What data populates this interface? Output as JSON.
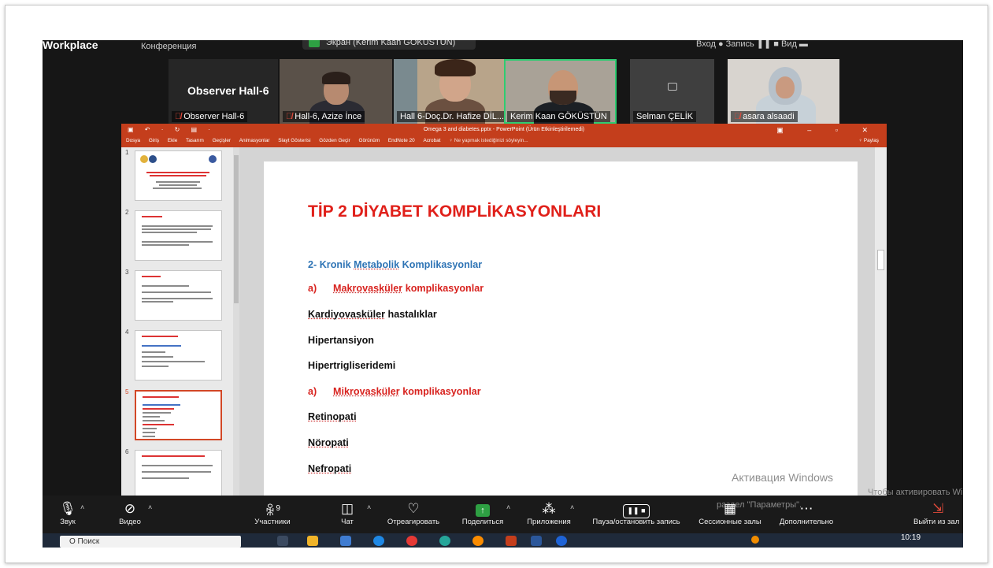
{
  "top": {
    "app_name": "Workplace",
    "conference_label": "Конференция",
    "share_pill": "Экран (Kerim Kaan GÖKÜSTÜN)",
    "right_status": "Вход   ●   Запись  ❚❚  ■   Вид  ▬"
  },
  "participants": [
    {
      "name": "Observer Hall-6",
      "big_label": "Observer Hall-6",
      "muted": true
    },
    {
      "name": "Hall-6, Azize İnce",
      "muted": true
    },
    {
      "name": "Hall 6-Doç.Dr. Hafize DİL...",
      "muted": false
    },
    {
      "name": "Kerim Kaan GÖKÜSTÜN",
      "muted": false,
      "active": true
    },
    {
      "name": "Selman ÇELİK",
      "muted": false
    },
    {
      "name": "asara alsaadi",
      "muted": true
    }
  ],
  "powerpoint": {
    "window_title": "Omega 3 and diabetes.pptx - PowerPoint (Ürün Etkinleştirilemedi)",
    "qat": "▣ ↶ · ↻ ▤ ·",
    "win_buttons": "▣ – ▫ ✕",
    "ribbon_tabs": [
      "Dosya",
      "Giriş",
      "Ekle",
      "Tasarım",
      "Geçişler",
      "Animasyonlar",
      "Slayt Gösterisi",
      "Gözden Geçir",
      "Görünüm",
      "EndNote 20",
      "Acrobat",
      "♀ Ne yapmak istediğinizi söyleyin..."
    ],
    "share_label": "♀ Paylaş",
    "thumb_numbers": [
      "1",
      "2",
      "3",
      "4",
      "5",
      "6"
    ]
  },
  "slide": {
    "title": "TİP 2 DİYABET KOMPLİKASYONLARI",
    "heading_prefix": "2- Kronik ",
    "heading_ul": "Metabolik",
    "heading_suffix": " Komplikasyonlar",
    "macro_letter": "a)",
    "macro_ul": "Makrovasküler",
    "macro_suffix": " komplikasyonlar",
    "cardio_ul": "Kardiyovasküler",
    "cardio_suffix": " hastalıklar",
    "hypertension": "Hipertansiyon",
    "hypertrig": "Hipertrigliseridemi",
    "micro_letter": "a)",
    "micro_ul": "Mikrovasküler",
    "micro_suffix": " komplikasyonlar",
    "retinopathy": "Retinopati",
    "neuropathy": "Nöropati",
    "nephropathy": "Nefropati"
  },
  "watermark": {
    "line1": "Активация Windows",
    "line2": "Чтобы активировать Windows, перейдите в",
    "line3": "раздел \"Параметры\"."
  },
  "toolbar": {
    "audio": "Звук",
    "video": "Видео",
    "participants": "Участники",
    "participants_count": "9",
    "chat": "Чат",
    "react": "Отреагировать",
    "share": "Поделиться",
    "apps": "Приложения",
    "pause_record": "Пауза/остановить запись",
    "breakout": "Сессионные залы",
    "more": "Дополнительно",
    "leave": "Выйти из зал"
  },
  "taskbar": {
    "search_placeholder": "О Поиск",
    "time": "10:19"
  },
  "colors": {
    "ppt_red": "#c43e1c",
    "slide_title": "#e0201a",
    "slide_blue": "#2e74b5",
    "active_speaker": "#2ecc71",
    "share_green": "#2ea043"
  }
}
